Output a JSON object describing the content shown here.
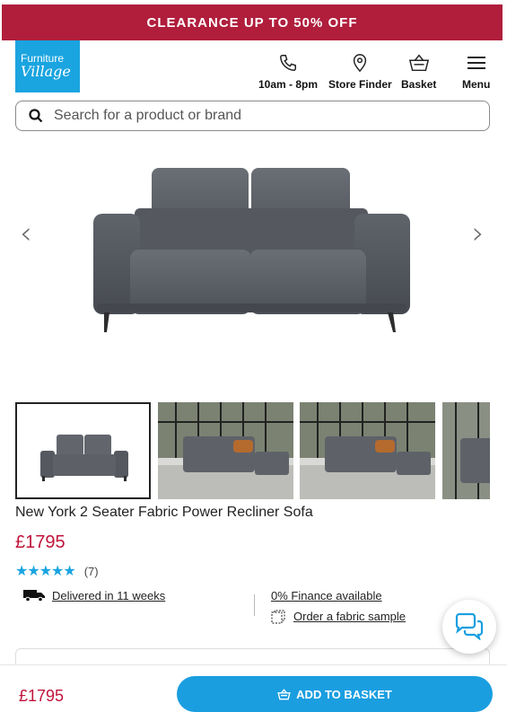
{
  "promo": {
    "text": "CLEARANCE UP TO 50% OFF"
  },
  "logo": {
    "line1": "Furniture",
    "line2": "Village"
  },
  "nav": {
    "hours": "10am - 8pm",
    "store_finder": "Store Finder",
    "basket": "Basket",
    "menu": "Menu"
  },
  "search": {
    "placeholder": "Search for a product or brand"
  },
  "gallery": {
    "prev": "‹",
    "next": "›"
  },
  "product": {
    "title": "New York 2 Seater Fabric Power Recliner Sofa",
    "price": "£1795",
    "stars": "★★★★★",
    "rating_count": "(7)",
    "delivery": "Delivered in 11 weeks",
    "finance": "0% Finance available",
    "fabric_sample": "Order a fabric sample"
  },
  "footer": {
    "price": "£1795",
    "add_to_basket": "ADD TO BASKET"
  },
  "colors": {
    "promo": "#b01e3c",
    "brand_blue": "#1aa4e0",
    "price": "#c0143c",
    "button": "#1a9ee0"
  }
}
